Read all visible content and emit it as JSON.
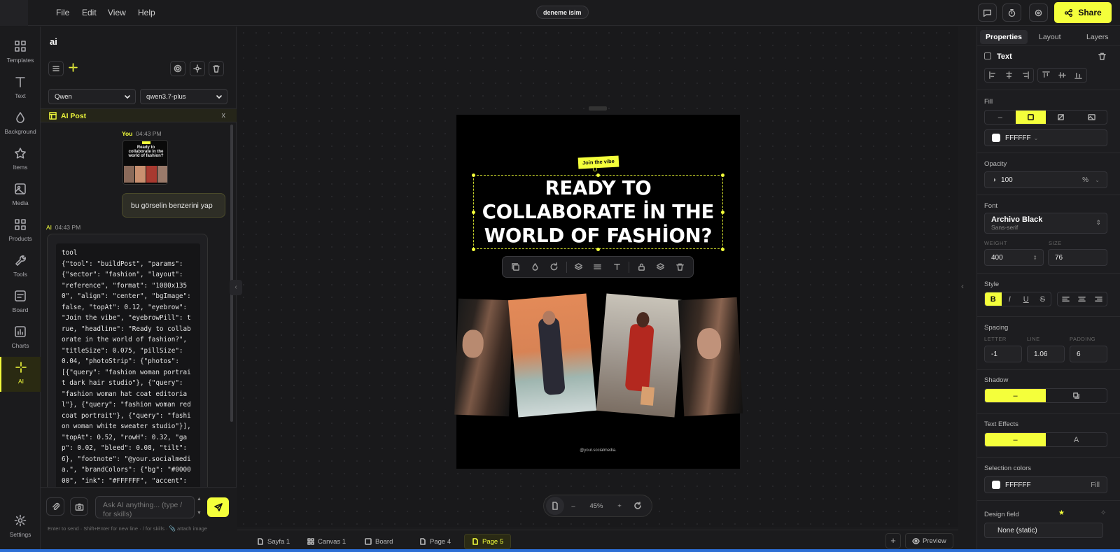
{
  "menu": {
    "file": "File",
    "edit": "Edit",
    "view": "View",
    "help": "Help"
  },
  "document_title": "deneme isim",
  "share_label": "Share",
  "rail": [
    {
      "label": "Templates",
      "icon": "grid-icon"
    },
    {
      "label": "Text",
      "icon": "text-icon"
    },
    {
      "label": "Background",
      "icon": "drop-icon"
    },
    {
      "label": "Items",
      "icon": "star-icon"
    },
    {
      "label": "Media",
      "icon": "image-icon"
    },
    {
      "label": "Products",
      "icon": "grid-icon"
    },
    {
      "label": "Tools",
      "icon": "wrench-icon"
    },
    {
      "label": "Board",
      "icon": "board-icon"
    },
    {
      "label": "Charts",
      "icon": "chart-icon"
    },
    {
      "label": "AI",
      "icon": "sparkle-icon"
    },
    {
      "label": "Settings",
      "icon": "gear-icon"
    }
  ],
  "chat": {
    "title": "ai",
    "provider": "Qwen",
    "model": "qwen3.7-plus",
    "panel_label": "AI Post",
    "close": "x",
    "you_label": "You",
    "you_time": "04:43 PM",
    "thumb_text": "Ready to collaborate in the world of fashion?",
    "user_message": "bu görselin benzerini yap",
    "ai_label": "AI",
    "ai_time": "04:43 PM",
    "tool_text": "tool\n{\"tool\": \"buildPost\", \"params\": {\"sector\": \"fashion\", \"layout\": \"reference\", \"format\": \"1080x1350\", \"align\": \"center\", \"bgImage\": false, \"topAt\": 0.12, \"eyebrow\": \"Join the vibe\", \"eyebrowPill\": true, \"headline\": \"Ready to collaborate in the world of fashion?\", \"titleSize\": 0.075, \"pillSize\": 0.04, \"photoStrip\": {\"photos\": [{\"query\": \"fashion woman portrait dark hair studio\"}, {\"query\": \"fashion woman hat coat editorial\"}, {\"query\": \"fashion woman red coat portrait\"}, {\"query\": \"fashion woman white sweater studio\"}], \"topAt\": 0.52, \"rowH\": 0.32, \"gap\": 0.02, \"bleed\": 0.08, \"tilt\": 6}, \"footnote\": \"@your.socialmedia.\", \"brandColors\": {\"bg\": \"#000000\", \"ink\": \"#FFFFFF\", \"accent\":",
    "input_placeholder": "Ask AI anything... (type / for skills)",
    "hint": "Enter to send · Shift+Enter for new line · / for skills · 📎 attach image"
  },
  "canvas": {
    "eyebrow": "Join the vibe",
    "headline": "READY TO COLLABORATE İN THE WORLD OF FASHİON?",
    "footnote": "@your.socialmedia.",
    "zoom": "45%"
  },
  "pages": [
    "Sayfa 1",
    "Canvas 1",
    "Board",
    "Page 4",
    "Page 5"
  ],
  "preview_label": "Preview",
  "props": {
    "tabs": [
      "Properties",
      "Layout",
      "Layers"
    ],
    "element_type": "Text",
    "fill_label": "Fill",
    "fill_color": "FFFFFF",
    "opacity_label": "Opacity",
    "opacity_value": "100",
    "opacity_unit": "%",
    "font_label": "Font",
    "font_name": "Archivo Black",
    "font_category": "Sans-serif",
    "weight_label": "WEIGHT",
    "weight_value": "400",
    "size_label": "SIZE",
    "size_value": "76",
    "style_label": "Style",
    "spacing_label": "Spacing",
    "letter_label": "LETTER",
    "letter_value": "-1",
    "line_label": "LINE",
    "line_value": "1.06",
    "padding_label": "PADDING",
    "padding_value": "6",
    "shadow_label": "Shadow",
    "effects_label": "Text Effects",
    "effects_letter": "A",
    "selection_label": "Selection colors",
    "selection_color": "FFFFFF",
    "selection_action": "Fill",
    "design_field_label": "Design field",
    "design_field_value": "None (static)",
    "accent": "#f4ff3b"
  }
}
